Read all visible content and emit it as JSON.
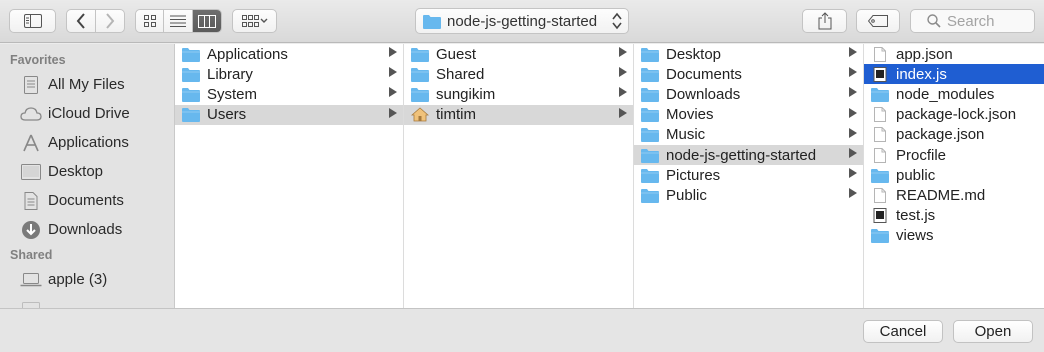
{
  "toolbar": {
    "current_folder": "node-js-getting-started",
    "search_placeholder": "Search",
    "view_mode": "columns"
  },
  "sidebar": {
    "favorites_heading": "Favorites",
    "favorites": [
      {
        "label": "All My Files",
        "icon": "all-files-icon"
      },
      {
        "label": "iCloud Drive",
        "icon": "cloud-icon"
      },
      {
        "label": "Applications",
        "icon": "applications-icon"
      },
      {
        "label": "Desktop",
        "icon": "desktop-icon"
      },
      {
        "label": "Documents",
        "icon": "documents-icon"
      },
      {
        "label": "Downloads",
        "icon": "downloads-icon"
      }
    ],
    "shared_heading": "Shared",
    "shared": [
      {
        "label": "apple (3)",
        "icon": "laptop-icon"
      }
    ]
  },
  "columns": [
    {
      "items": [
        {
          "label": "Applications",
          "folder": true
        },
        {
          "label": "Library",
          "folder": true
        },
        {
          "label": "System",
          "folder": true
        },
        {
          "label": "Users",
          "folder": true,
          "on_path": true
        }
      ]
    },
    {
      "items": [
        {
          "label": "Guest",
          "folder": true
        },
        {
          "label": "Shared",
          "folder": true
        },
        {
          "label": "sungikim",
          "folder": true
        },
        {
          "label": "timtim",
          "folder": true,
          "home": true,
          "on_path": true
        }
      ]
    },
    {
      "items": [
        {
          "label": "Desktop",
          "folder": true
        },
        {
          "label": "Documents",
          "folder": true
        },
        {
          "label": "Downloads",
          "folder": true
        },
        {
          "label": "Movies",
          "folder": true
        },
        {
          "label": "Music",
          "folder": true
        },
        {
          "label": "node-js-getting-started",
          "folder": true,
          "on_path": true
        },
        {
          "label": "Pictures",
          "folder": true
        },
        {
          "label": "Public",
          "folder": true
        }
      ]
    },
    {
      "items": [
        {
          "label": "app.json",
          "type": "file"
        },
        {
          "label": "index.js",
          "type": "script",
          "selected": true
        },
        {
          "label": "node_modules",
          "type": "folder"
        },
        {
          "label": "package-lock.json",
          "type": "file"
        },
        {
          "label": "package.json",
          "type": "file"
        },
        {
          "label": "Procfile",
          "type": "file"
        },
        {
          "label": "public",
          "type": "folder"
        },
        {
          "label": "README.md",
          "type": "file"
        },
        {
          "label": "test.js",
          "type": "script"
        },
        {
          "label": "views",
          "type": "folder"
        }
      ]
    }
  ],
  "buttons": {
    "cancel": "Cancel",
    "open": "Open"
  },
  "colors": {
    "selection": "#1f5ed2",
    "folder": "#67b8ee",
    "path_highlight": "#d8d8d8"
  }
}
